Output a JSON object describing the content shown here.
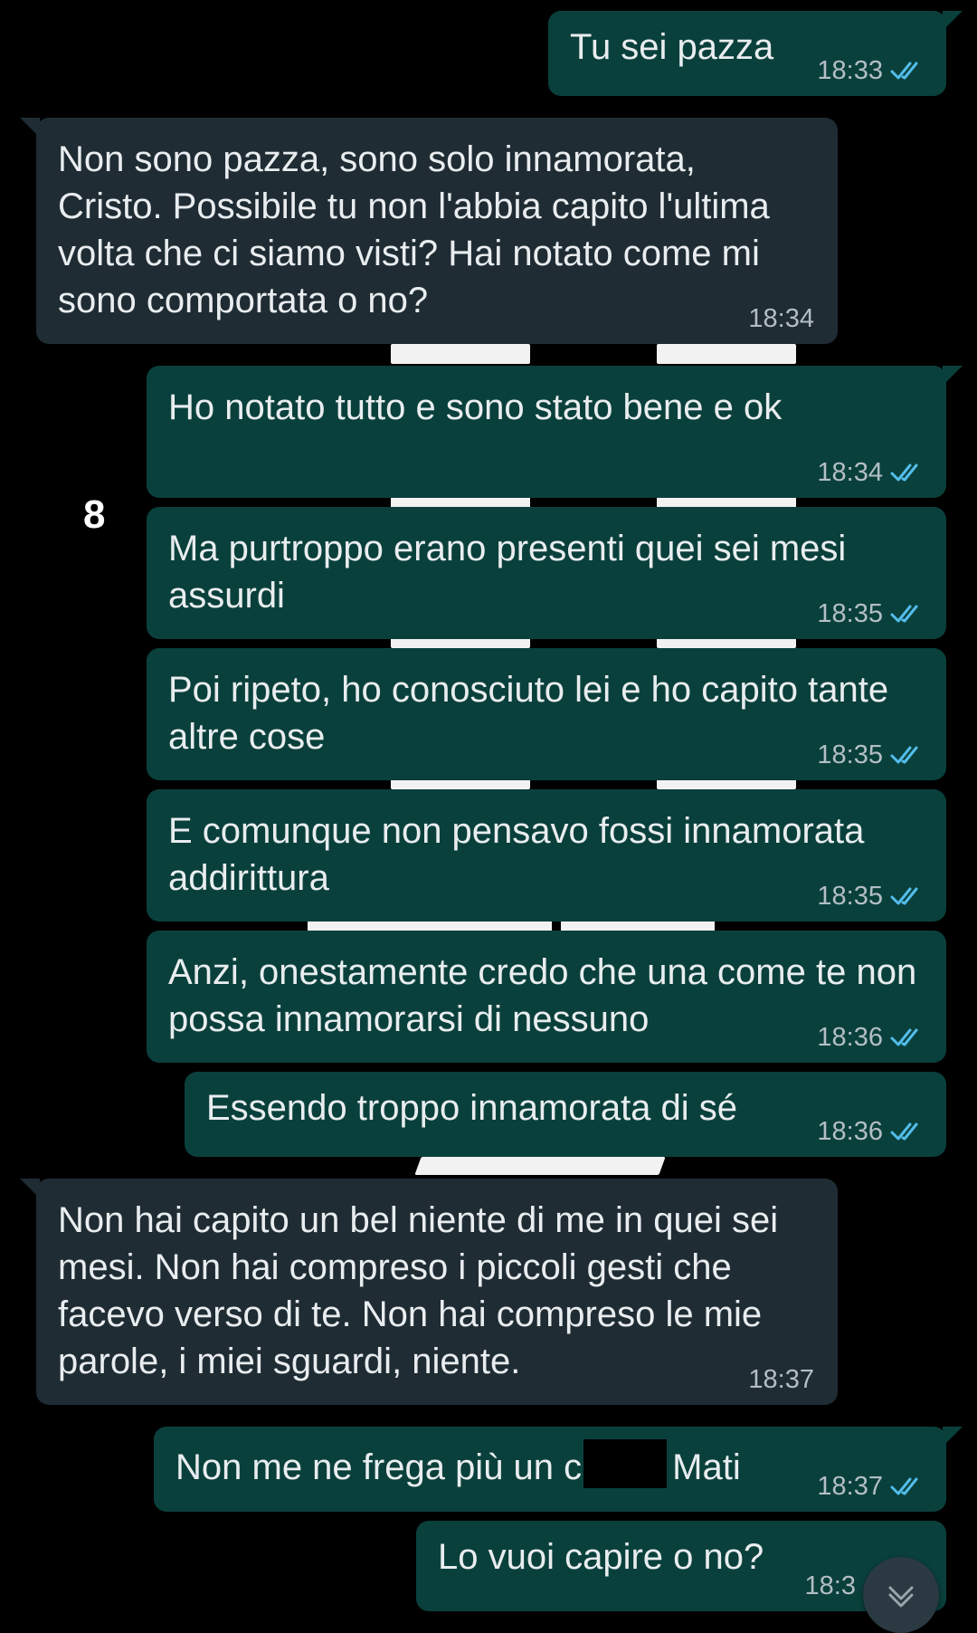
{
  "colors": {
    "outgoing_bubble": "#0a403c",
    "incoming_bubble": "#1f2c34",
    "read_ticks": "#53bdeb",
    "background": "#000000"
  },
  "side_label": "8",
  "messages": [
    {
      "direction": "out",
      "text": "Tu sei pazza",
      "time": "18:33",
      "status": "read"
    },
    {
      "direction": "in",
      "text": "Non sono pazza, sono solo innamorata, Cristo. Possibile tu non l'abbia capito l'ultima volta che ci siamo visti? Hai notato come mi sono comportata o no?",
      "time": "18:34"
    },
    {
      "direction": "out",
      "text": "Ho notato tutto e sono stato bene e ok",
      "time": "18:34",
      "status": "read"
    },
    {
      "direction": "out",
      "text": "Ma purtroppo erano presenti quei sei mesi assurdi",
      "time": "18:35",
      "status": "read"
    },
    {
      "direction": "out",
      "text": "Poi ripeto, ho conosciuto lei e ho capito tante altre cose",
      "time": "18:35",
      "status": "read"
    },
    {
      "direction": "out",
      "text": "E comunque non pensavo fossi innamorata addirittura",
      "time": "18:35",
      "status": "read"
    },
    {
      "direction": "out",
      "text": "Anzi, onestamente credo che una come te non possa innamorarsi di nessuno",
      "time": "18:36",
      "status": "read"
    },
    {
      "direction": "out",
      "text": "Essendo troppo innamorata di sé",
      "time": "18:36",
      "status": "read"
    },
    {
      "direction": "in",
      "text": "Non hai capito un bel niente di me in quei sei mesi. Non hai compreso i piccoli gesti che facevo verso di te. Non hai compreso le mie parole, i miei sguardi, niente.",
      "time": "18:37"
    },
    {
      "direction": "out",
      "text_before": "Non me ne frega più un c",
      "text_after": "Mati",
      "time": "18:37",
      "status": "read"
    },
    {
      "direction": "out",
      "text": "Lo vuoi capire o no?",
      "time": "18:3",
      "status": "read"
    }
  ],
  "scroll_button": {
    "icon": "chevron-down-icon"
  }
}
